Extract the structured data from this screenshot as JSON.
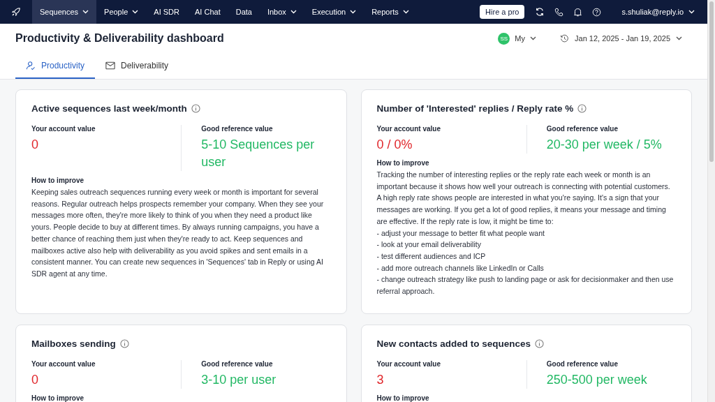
{
  "nav": {
    "items": [
      {
        "label": "Sequences",
        "dropdown": true,
        "selected": true
      },
      {
        "label": "People",
        "dropdown": true,
        "selected": false
      },
      {
        "label": "AI SDR",
        "dropdown": false,
        "selected": false
      },
      {
        "label": "AI Chat",
        "dropdown": false,
        "selected": false
      },
      {
        "label": "Data",
        "dropdown": false,
        "selected": false
      },
      {
        "label": "Inbox",
        "dropdown": true,
        "selected": false
      },
      {
        "label": "Execution",
        "dropdown": true,
        "selected": false
      },
      {
        "label": "Reports",
        "dropdown": true,
        "selected": false
      }
    ],
    "hire_button": "Hire a pro",
    "user_email": "s.shuliak@reply.io"
  },
  "header": {
    "title": "Productivity & Deliverability dashboard",
    "owner": {
      "initials": "SS",
      "label": "My"
    },
    "date_range": "Jan 12, 2025 - Jan 19, 2025"
  },
  "tabs": [
    {
      "label": "Productivity",
      "selected": true
    },
    {
      "label": "Deliverability",
      "selected": false
    }
  ],
  "cards": [
    {
      "title": "Active sequences last week/month",
      "account_label": "Your account value",
      "account_value": "0",
      "reference_label": "Good reference value",
      "reference_value": "5-10 Sequences per user",
      "improve_label": "How to improve",
      "improve_text": [
        "Keeping sales outreach sequences running every week or month is important for several reasons. Regular outreach helps prospects remember your company. When they see your messages more often, they're more likely to think of you when they need a product like yours. People decide to buy at different times. By always running campaigns, you have a better chance of reaching them just when they're ready to act. Keep sequences and mailboxes active also help with deliverability as you avoid spikes and sent emails in a consistent manner. You can create new sequences in 'Sequences' tab in Reply or using AI SDR agent at any time."
      ]
    },
    {
      "title": "Number of 'Interested' replies / Reply rate %",
      "account_label": "Your account value",
      "account_value": "0 / 0%",
      "reference_label": "Good reference value",
      "reference_value": "20-30 per week / 5%",
      "improve_label": "How to improve",
      "improve_text": [
        "Tracking the number of interesting replies or the reply rate each week or month is an important because it shows how well your outreach is connecting with potential customers. A high reply rate shows people are interested in what you're saying. It's a sign that your messages are working. If you get a lot of good replies, it means your message and timing are effective. If the reply rate is low, it might be time to:",
        "- adjust your message to better fit what people want",
        "- look at your email deliverability",
        "- test different audiences and ICP",
        "- add more outreach channels like LinkedIn or Calls",
        "- change outreach strategy like push to landing page or ask for decisionmaker and then use referral approach."
      ]
    },
    {
      "title": "Mailboxes sending",
      "account_label": "Your account value",
      "account_value": "0",
      "reference_label": "Good reference value",
      "reference_value": "3-10 per user",
      "improve_label": "How to improve"
    },
    {
      "title": "New contacts added to sequences",
      "account_label": "Your account value",
      "account_value": "3",
      "reference_label": "Good reference value",
      "reference_value": "250-500 per week",
      "improve_label": "How to improve"
    }
  ]
}
